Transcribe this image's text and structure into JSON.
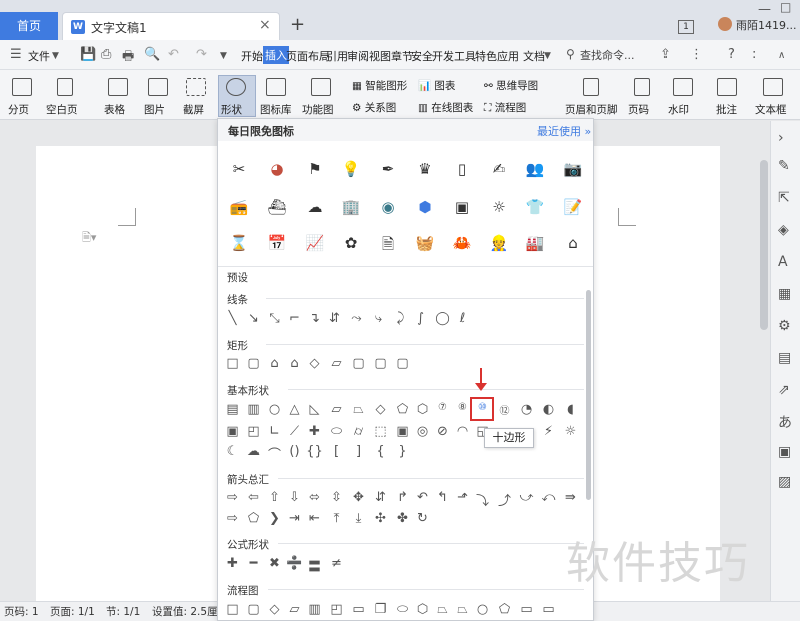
{
  "tabs": {
    "home": "首页",
    "doc_title": "文字文稿1",
    "doc_icon": "W",
    "close": "×",
    "new": "+"
  },
  "window": {
    "tab_count": "1",
    "username": "雨陌1419...",
    "min": "—",
    "max": "□"
  },
  "menu": {
    "file": "文件",
    "items": [
      "开始",
      "插入",
      "页面布局",
      "引用",
      "审阅",
      "视图",
      "章节",
      "安全",
      "开发工具",
      "特色应用",
      "文档"
    ],
    "active": "插入",
    "search": "查找命令..."
  },
  "ribbon": {
    "page_break": "分页",
    "blank_page": "空白页",
    "table": "表格",
    "picture": "图片",
    "screenshot": "截屏",
    "shapes": "形状",
    "icon_lib": "图标库",
    "func_chart": "功能图",
    "smart_shape": "智能图形",
    "chart": "图表",
    "mind_map": "思维导图",
    "relation": "关系图",
    "online_chart": "在线图表",
    "flowchart": "流程图",
    "header_footer": "页眉和页脚",
    "page_num": "页码",
    "watermark": "水印",
    "comment": "批注",
    "textbox": "文本框"
  },
  "panel": {
    "title": "每日限免图标",
    "recent": "最近使用 »",
    "preset": "预设",
    "sections": {
      "lines": "线条",
      "rect": "矩形",
      "basic": "基本形状",
      "arrows": "箭头总汇",
      "formula": "公式形状",
      "flow": "流程图"
    },
    "tooltip": "十边形"
  },
  "status": {
    "page_code": "页码: 1",
    "page": "页面: 1/1",
    "section": "节: 1/1",
    "setting": "设置值: 2.5厘米"
  },
  "watermark": "软件技巧",
  "colors": {
    "accent": "#3f7be0",
    "highlight": "#d9322f"
  }
}
